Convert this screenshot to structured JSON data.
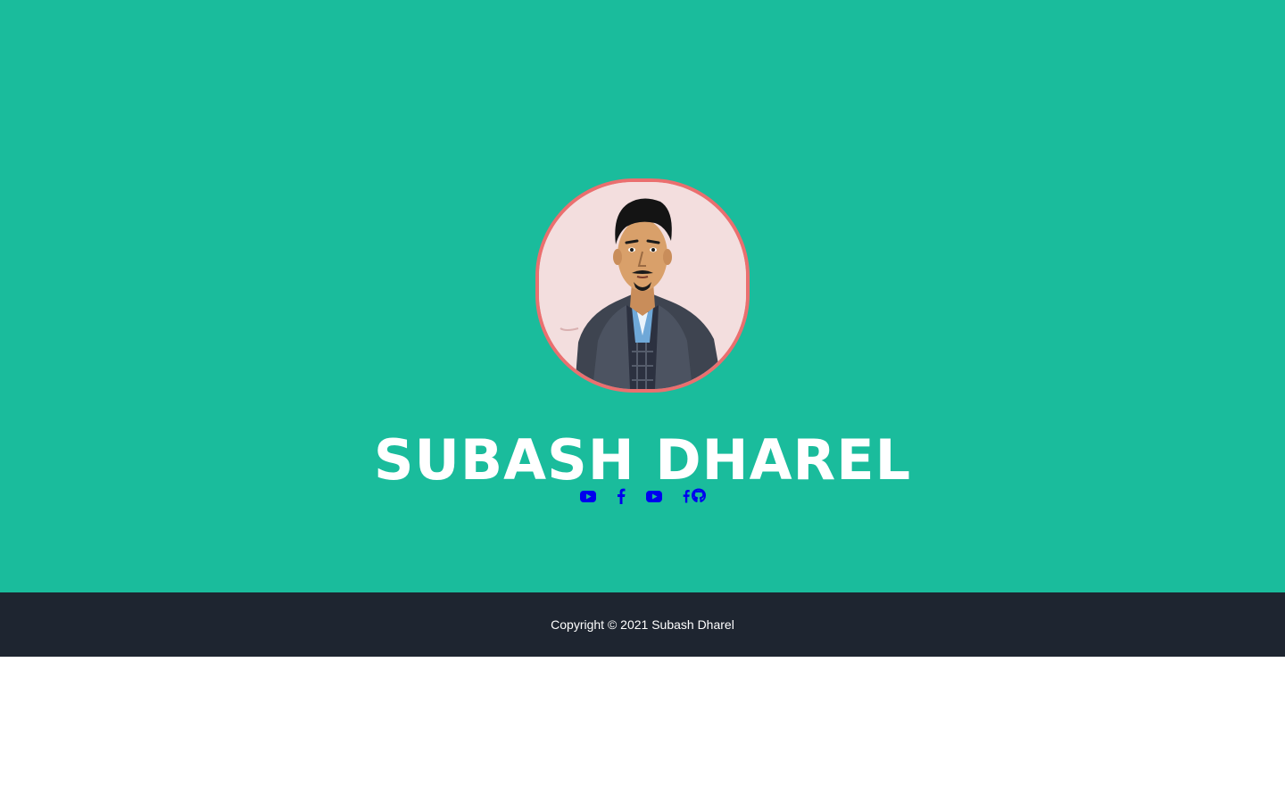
{
  "hero": {
    "background_color": "#1abc9c",
    "name": "SUBASH DHAREL",
    "avatar": {
      "icon": "portrait-avatar",
      "border_color": "#ea6f6f",
      "background_color": "#f3dede"
    },
    "social_links": [
      {
        "icon": "youtube-icon",
        "color": "#0000ee"
      },
      {
        "icon": "facebook-icon",
        "color": "#0000ee"
      },
      {
        "icon": "youtube-icon",
        "color": "#0000ee"
      },
      {
        "icon": "facebook-icon",
        "color": "#0000ee"
      },
      {
        "icon": "github-icon",
        "color": "#0000ee"
      }
    ]
  },
  "footer": {
    "background_color": "#1e2530",
    "copyright": "Copyright © 2021 Subash Dharel"
  }
}
